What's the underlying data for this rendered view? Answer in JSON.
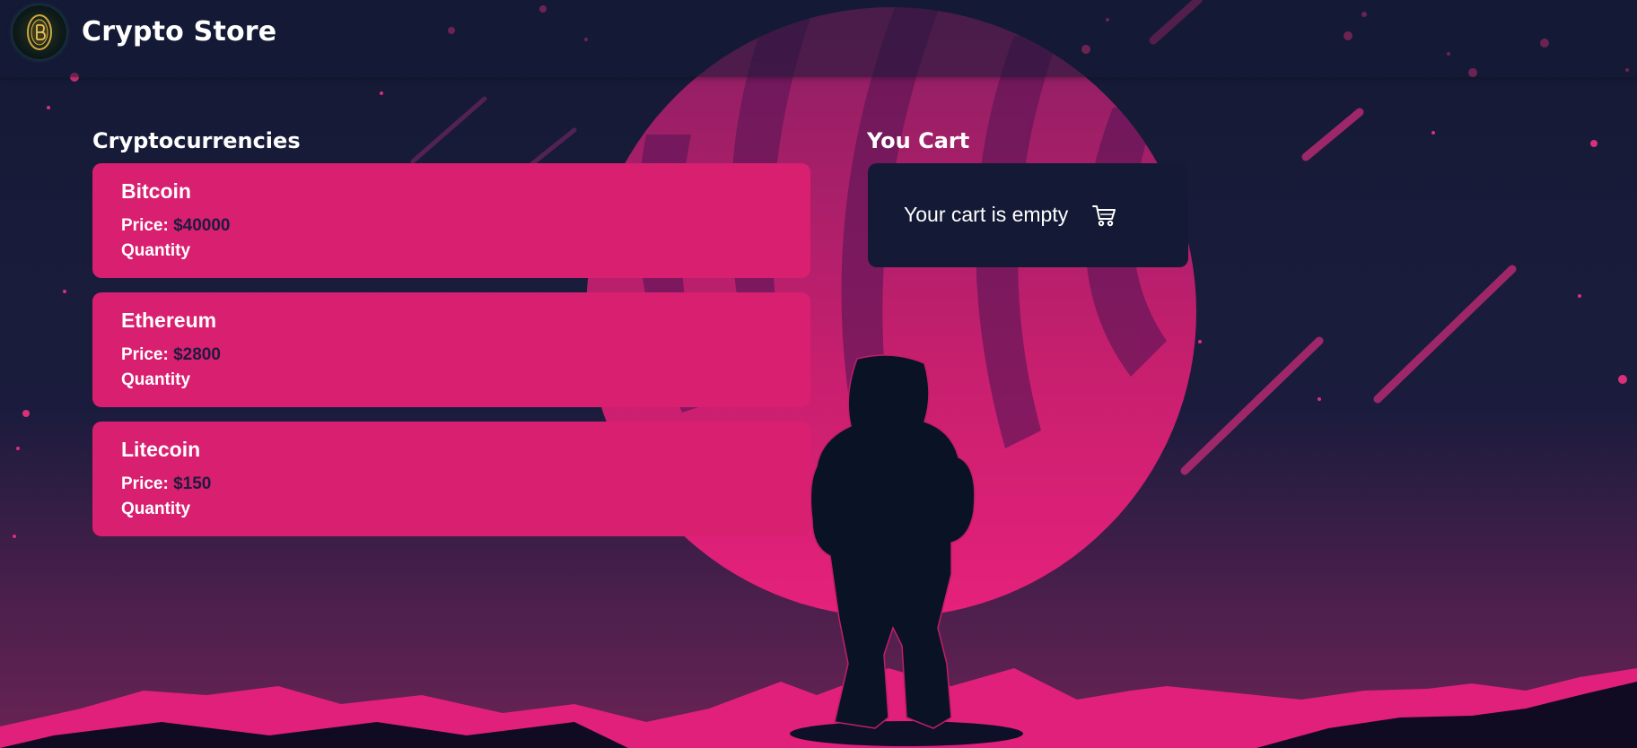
{
  "header": {
    "title": "Crypto Store",
    "logo_icon": "bitcoin-coin-icon"
  },
  "cryptocurrencies": {
    "heading": "Cryptocurrencies",
    "price_label": "Price:",
    "quantity_label": "Quantity",
    "items": [
      {
        "name": "Bitcoin",
        "price": "$40000"
      },
      {
        "name": "Ethereum",
        "price": "$2800"
      },
      {
        "name": "Litecoin",
        "price": "$150"
      }
    ]
  },
  "cart": {
    "heading": "You Cart",
    "empty_text": "Your cart is empty",
    "icon": "shopping-cart-icon"
  },
  "colors": {
    "card": "#d81f70",
    "background": "#141a35",
    "price_value": "#1e1b3e",
    "accent_pink": "#e8207a"
  }
}
